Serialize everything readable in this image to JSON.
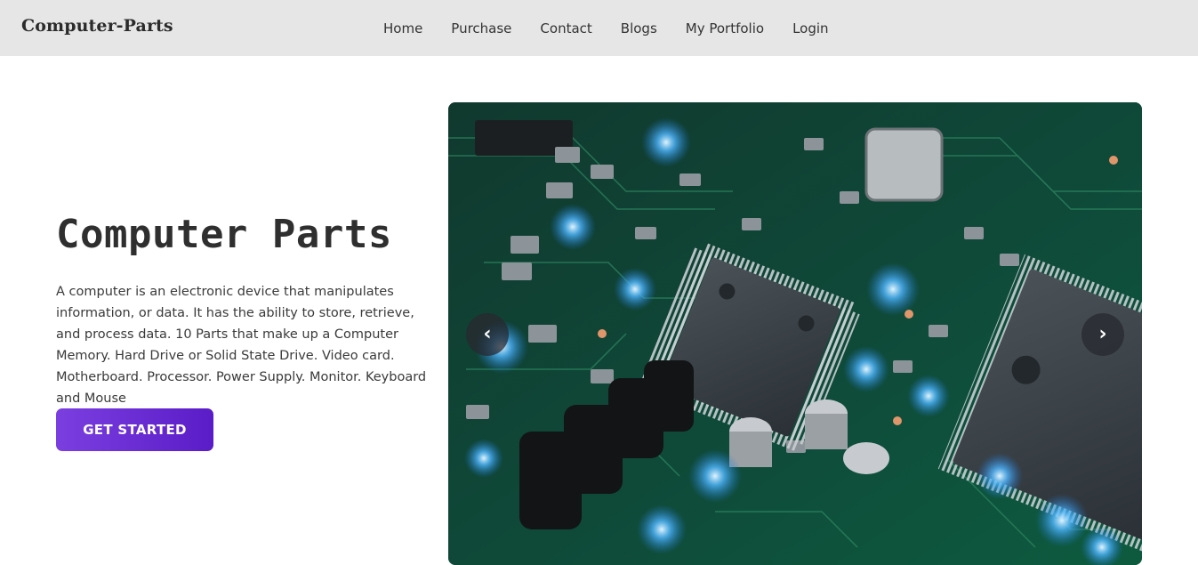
{
  "nav": {
    "brand": "Computer-Parts",
    "links": [
      "Home",
      "Purchase",
      "Contact",
      "Blogs",
      "My Portfolio",
      "Login"
    ]
  },
  "hero": {
    "title": "Computer Parts",
    "description": "A computer is an electronic device that manipulates information, or data. It has the ability to store, retrieve, and process data. 10 Parts that make up a Computer Memory. Hard Drive or Solid State Drive. Video card. Motherboard. Processor. Power Supply. Monitor. Keyboard and Mouse",
    "cta_label": "GET STARTED"
  },
  "carousel": {
    "prev_icon": "‹",
    "next_icon": "›",
    "image_subject": "circuit board with microchips"
  },
  "colors": {
    "navbar_bg": "#e6e6e6",
    "button_gradient_start": "#7b3fe0",
    "button_gradient_end": "#5a1cc7"
  }
}
